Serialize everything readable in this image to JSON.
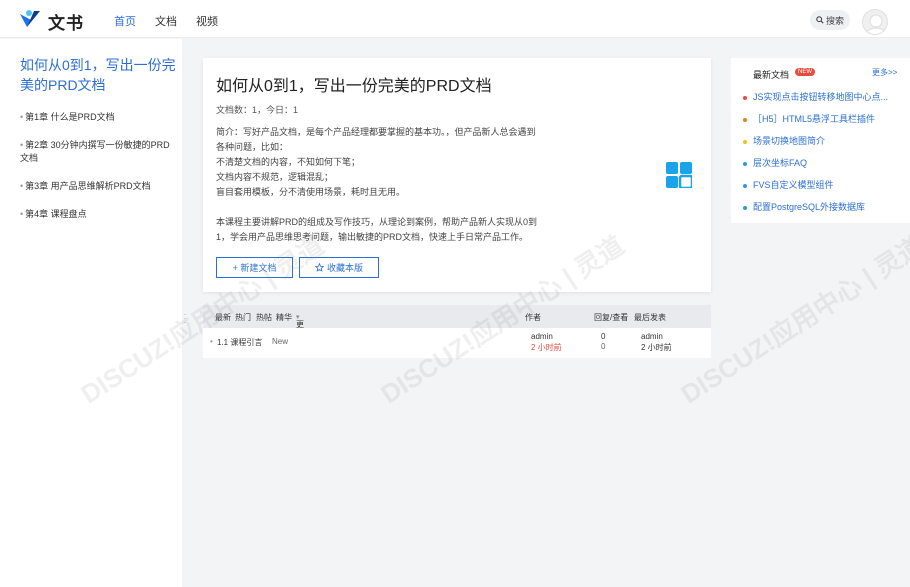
{
  "header": {
    "brand": "文书",
    "nav": [
      {
        "label": "首页",
        "active": true
      },
      {
        "label": "文档",
        "active": false
      },
      {
        "label": "视频",
        "active": false
      }
    ],
    "search_label": "搜索"
  },
  "sidebar": {
    "title": "如何从0到1，写出一份完美的PRD文档",
    "chapters": [
      {
        "label": "第1章 什么是PRD文档"
      },
      {
        "label": "第2章 30分钟内撰写一份敏捷的PRD文档"
      },
      {
        "label": "第3章 用产品思维解析PRD文档"
      },
      {
        "label": "第4章 课程盘点"
      }
    ]
  },
  "main": {
    "title": "如何从0到1，写出一份完美的PRD文档",
    "doc_count": "文档数：1，今日：1",
    "description": "简介：写好产品文档，是每个产品经理都要掌握的基本功。，但产品新人总会遇到各种问题，比如：\n不清楚文档的内容，不知如何下笔；\n文档内容不规范，逻辑混乱；\n盲目套用模板，分不清使用场景，耗时且无用。\n\n本课程主要讲解PRD的组成及写作技巧，从理论到案例，帮助产品新人实现从0到1，学会用产品思维思考问题，输出敏捷的PRD文档，快速上手日常产品工作。",
    "new_doc_button": "+ 新建文档",
    "collect_button": "收藏本版"
  },
  "threads": {
    "filters": [
      "最新",
      "热门",
      "热帖",
      "精华",
      "更多"
    ],
    "col_author": "作者",
    "col_replies": "回复/查看",
    "col_last": "最后发表",
    "rows": [
      {
        "title": "1.1 课程引言",
        "tag": "New",
        "author": "admin",
        "author_time": "2 小时前",
        "replies": "0",
        "views": "0",
        "last_author": "admin",
        "last_time": "2 小时前"
      }
    ]
  },
  "right": {
    "title": "最新文档",
    "badge": "NEW",
    "more": "更多>>",
    "items": [
      {
        "label": "JS实现点击按钮转移地图中心点...",
        "color": "#e74c3c"
      },
      {
        "label": "［H5］HTML5悬浮工具栏插件",
        "color": "#e67e22"
      },
      {
        "label": "场景切换地图简介",
        "color": "#f1c40f"
      },
      {
        "label": "层次坐标FAQ",
        "color": "#3498db"
      },
      {
        "label": "FVS自定义模型组件",
        "color": "#3498db"
      },
      {
        "label": "配置PostgreSQL外接数据库",
        "color": "#3498db"
      }
    ]
  },
  "colors": {
    "accent": "#2b6fd6",
    "time_red": "#e74c3c"
  }
}
